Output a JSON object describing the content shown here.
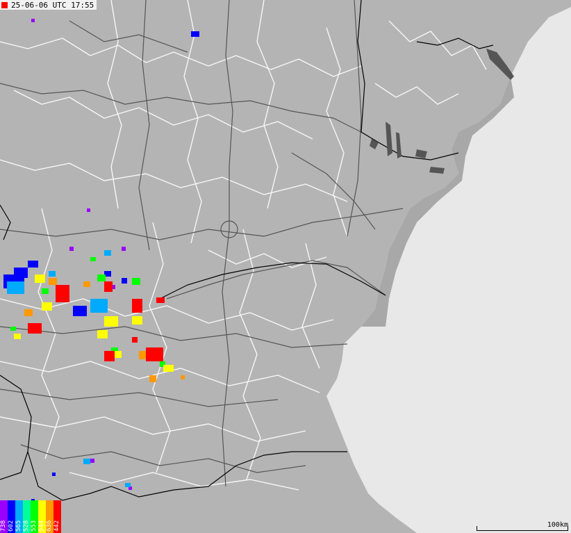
{
  "timestamp": "25-06-06 UTC 17:55",
  "legend": {
    "items": [
      {
        "label": "738",
        "color": "#9900ff"
      },
      {
        "label": "602",
        "color": "#0000ff"
      },
      {
        "label": "565",
        "color": "#00aaff"
      },
      {
        "label": "528",
        "color": "#00ff99"
      },
      {
        "label": "553",
        "color": "#00ff00"
      },
      {
        "label": "544",
        "color": "#ffff00"
      },
      {
        "label": "636",
        "color": "#ff9900"
      },
      {
        "label": "442",
        "color": "#ff0000"
      }
    ]
  },
  "scale": {
    "label": "100km"
  },
  "colors": {
    "land": "#b4b4b4",
    "sea": "#e8e8e8",
    "admin_borders": "#ffffff",
    "roads": "#555555",
    "lakes": "#555555"
  }
}
